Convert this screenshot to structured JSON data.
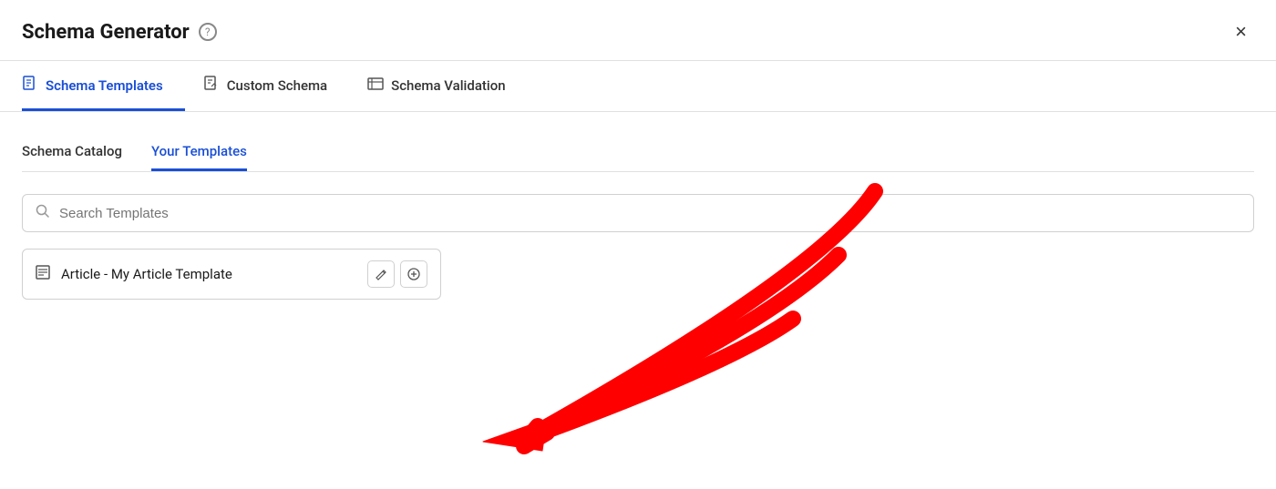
{
  "modal": {
    "title": "Schema Generator",
    "help_icon": "?",
    "close_label": "×"
  },
  "tabs_top": [
    {
      "label": "Schema Templates",
      "icon": "📄",
      "active": true
    },
    {
      "label": "Custom Schema",
      "icon": "📝",
      "active": false
    },
    {
      "label": "Schema Validation",
      "icon": "📊",
      "active": false
    }
  ],
  "sub_tabs": [
    {
      "label": "Schema Catalog",
      "active": false
    },
    {
      "label": "Your Templates",
      "active": true
    }
  ],
  "search": {
    "placeholder": "Search Templates"
  },
  "template_item": {
    "icon": "≡",
    "name": "Article - My Article Template",
    "edit_label": "✏",
    "add_label": "⊕"
  }
}
